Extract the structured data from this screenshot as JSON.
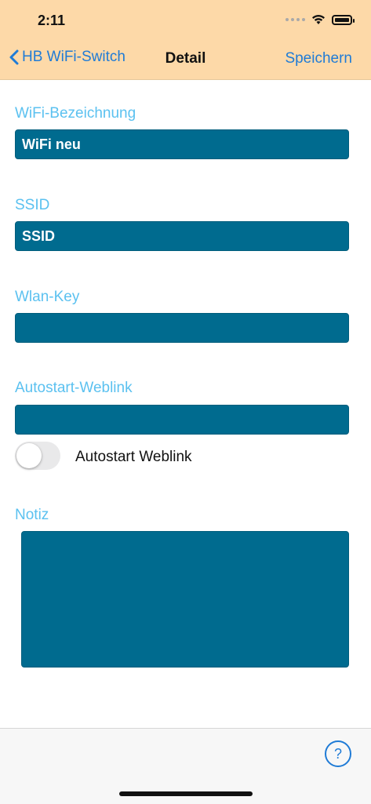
{
  "status_bar": {
    "time": "2:11",
    "signal_icon": "cellular-dots-icon",
    "wifi_icon": "wifi-icon",
    "battery_icon": "battery-icon"
  },
  "nav": {
    "back_label": "HB WiFi-Switch",
    "title": "Detail",
    "save_label": "Speichern"
  },
  "form": {
    "wifi_name": {
      "label": "WiFi-Bezeichnung",
      "value": "WiFi neu"
    },
    "ssid": {
      "label": "SSID",
      "value": "SSID"
    },
    "wlan_key": {
      "label": "Wlan-Key",
      "value": ""
    },
    "autostart_weblink": {
      "label": "Autostart-Weblink",
      "value": ""
    },
    "autostart_toggle": {
      "label": "Autostart Weblink",
      "on": false
    },
    "notes": {
      "label": "Notiz",
      "value": ""
    }
  },
  "toolbar": {
    "help_icon": "help-circle-icon",
    "help_symbol": "?"
  },
  "colors": {
    "header_bg": "#fdd9a8",
    "accent": "#1f7bd6",
    "label": "#5bc1f0",
    "field_bg": "#006b8f"
  }
}
